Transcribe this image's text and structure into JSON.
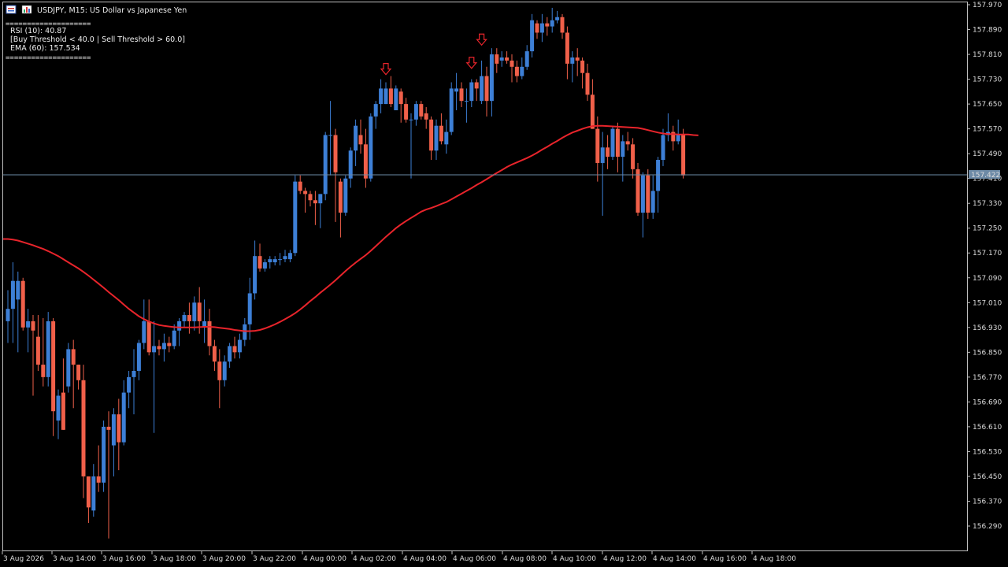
{
  "header": {
    "symbol_title": "USDJPY, M15:  US Dollar vs Japanese Yen"
  },
  "info_panel": {
    "separator": "====================",
    "rsi": "RSI (10): 40.87",
    "thresholds": "[Buy Threshold < 40.0 | Sell Threshold > 60.0]",
    "ema": "EMA (60): 157.534"
  },
  "price_scale": [
    "157.970",
    "157.890",
    "157.810",
    "157.730",
    "157.650",
    "157.570",
    "157.490",
    "157.410",
    "157.330",
    "157.250",
    "157.170",
    "157.090",
    "157.010",
    "156.930",
    "156.850",
    "156.770",
    "156.690",
    "156.610",
    "156.530",
    "156.450",
    "156.370",
    "156.290"
  ],
  "time_scale": [
    "3 Aug 2026",
    "3 Aug 14:00",
    "3 Aug 16:00",
    "3 Aug 18:00",
    "3 Aug 20:00",
    "3 Aug 22:00",
    "4 Aug 00:00",
    "4 Aug 02:00",
    "4 Aug 04:00",
    "4 Aug 06:00",
    "4 Aug 08:00",
    "4 Aug 10:00",
    "4 Aug 12:00",
    "4 Aug 14:00",
    "4 Aug 16:00",
    "4 Aug 18:00"
  ],
  "current_price": {
    "label": "157.422",
    "value": 157.422
  },
  "colors": {
    "background": "#000000",
    "bull": "#3d7fd6",
    "bear": "#f0604a",
    "ema": "#e8242b",
    "price_line": "#6d8aa6",
    "axis": "#cccccc"
  },
  "chart_data": {
    "type": "candlestick",
    "symbol": "USDJPY",
    "timeframe": "M15",
    "ylim": [
      156.25,
      157.985
    ],
    "candles": [
      {
        "o": 156.95,
        "h": 157.05,
        "l": 156.88,
        "c": 156.99
      },
      {
        "o": 156.99,
        "h": 157.14,
        "l": 156.88,
        "c": 157.08
      },
      {
        "o": 157.02,
        "h": 157.11,
        "l": 156.85,
        "c": 157.08
      },
      {
        "o": 157.08,
        "h": 157.09,
        "l": 156.92,
        "c": 156.93
      },
      {
        "o": 156.93,
        "h": 156.99,
        "l": 156.85,
        "c": 156.95
      },
      {
        "o": 156.95,
        "h": 156.97,
        "l": 156.71,
        "c": 156.92
      },
      {
        "o": 156.9,
        "h": 156.97,
        "l": 156.79,
        "c": 156.81
      },
      {
        "o": 156.81,
        "h": 156.96,
        "l": 156.74,
        "c": 156.77
      },
      {
        "o": 156.77,
        "h": 156.98,
        "l": 156.74,
        "c": 156.95
      },
      {
        "o": 156.95,
        "h": 156.96,
        "l": 156.58,
        "c": 156.66
      },
      {
        "o": 156.63,
        "h": 156.73,
        "l": 156.57,
        "c": 156.71
      },
      {
        "o": 156.72,
        "h": 156.83,
        "l": 156.6,
        "c": 156.6
      },
      {
        "o": 156.74,
        "h": 156.88,
        "l": 156.72,
        "c": 156.86
      },
      {
        "o": 156.86,
        "h": 156.89,
        "l": 156.67,
        "c": 156.81
      },
      {
        "o": 156.81,
        "h": 156.81,
        "l": 156.73,
        "c": 156.76
      },
      {
        "o": 156.76,
        "h": 156.81,
        "l": 156.38,
        "c": 156.45
      },
      {
        "o": 156.45,
        "h": 156.45,
        "l": 156.3,
        "c": 156.35
      },
      {
        "o": 156.34,
        "h": 156.49,
        "l": 156.32,
        "c": 156.45
      },
      {
        "o": 156.45,
        "h": 156.55,
        "l": 156.4,
        "c": 156.43
      },
      {
        "o": 156.43,
        "h": 156.63,
        "l": 156.4,
        "c": 156.61
      },
      {
        "o": 156.61,
        "h": 156.66,
        "l": 156.25,
        "c": 156.6
      },
      {
        "o": 156.55,
        "h": 156.67,
        "l": 156.45,
        "c": 156.65
      },
      {
        "o": 156.65,
        "h": 156.7,
        "l": 156.47,
        "c": 156.56
      },
      {
        "o": 156.56,
        "h": 156.76,
        "l": 156.55,
        "c": 156.72
      },
      {
        "o": 156.72,
        "h": 156.79,
        "l": 156.67,
        "c": 156.77
      },
      {
        "o": 156.77,
        "h": 156.86,
        "l": 156.65,
        "c": 156.79
      },
      {
        "o": 156.79,
        "h": 156.89,
        "l": 156.76,
        "c": 156.88
      },
      {
        "o": 156.88,
        "h": 157.02,
        "l": 156.86,
        "c": 156.95
      },
      {
        "o": 156.95,
        "h": 157.02,
        "l": 156.84,
        "c": 156.85
      },
      {
        "o": 156.85,
        "h": 156.95,
        "l": 156.59,
        "c": 156.87
      },
      {
        "o": 156.87,
        "h": 156.89,
        "l": 156.84,
        "c": 156.86
      },
      {
        "o": 156.86,
        "h": 156.91,
        "l": 156.82,
        "c": 156.88
      },
      {
        "o": 156.88,
        "h": 156.9,
        "l": 156.85,
        "c": 156.87
      },
      {
        "o": 156.87,
        "h": 156.94,
        "l": 156.86,
        "c": 156.92
      },
      {
        "o": 156.92,
        "h": 156.96,
        "l": 156.87,
        "c": 156.95
      },
      {
        "o": 156.95,
        "h": 156.98,
        "l": 156.93,
        "c": 156.97
      },
      {
        "o": 156.97,
        "h": 157.01,
        "l": 156.91,
        "c": 156.95
      },
      {
        "o": 156.95,
        "h": 157.03,
        "l": 156.92,
        "c": 157.01
      },
      {
        "o": 157.01,
        "h": 157.06,
        "l": 156.91,
        "c": 156.95
      },
      {
        "o": 156.93,
        "h": 157.02,
        "l": 156.88,
        "c": 156.95
      },
      {
        "o": 156.95,
        "h": 156.99,
        "l": 156.84,
        "c": 156.87
      },
      {
        "o": 156.87,
        "h": 156.89,
        "l": 156.79,
        "c": 156.82
      },
      {
        "o": 156.82,
        "h": 156.86,
        "l": 156.67,
        "c": 156.76
      },
      {
        "o": 156.76,
        "h": 156.84,
        "l": 156.74,
        "c": 156.82
      },
      {
        "o": 156.82,
        "h": 156.88,
        "l": 156.8,
        "c": 156.87
      },
      {
        "o": 156.87,
        "h": 156.9,
        "l": 156.83,
        "c": 156.85
      },
      {
        "o": 156.85,
        "h": 156.91,
        "l": 156.83,
        "c": 156.89
      },
      {
        "o": 156.89,
        "h": 156.96,
        "l": 156.87,
        "c": 156.94
      },
      {
        "o": 156.94,
        "h": 157.09,
        "l": 156.89,
        "c": 157.04
      },
      {
        "o": 157.04,
        "h": 157.21,
        "l": 157.02,
        "c": 157.16
      },
      {
        "o": 157.16,
        "h": 157.2,
        "l": 157.11,
        "c": 157.12
      },
      {
        "o": 157.12,
        "h": 157.15,
        "l": 157.11,
        "c": 157.14
      },
      {
        "o": 157.14,
        "h": 157.16,
        "l": 157.12,
        "c": 157.15
      },
      {
        "o": 157.14,
        "h": 157.16,
        "l": 157.13,
        "c": 157.15
      },
      {
        "o": 157.15,
        "h": 157.17,
        "l": 157.13,
        "c": 157.15
      },
      {
        "o": 157.15,
        "h": 157.18,
        "l": 157.14,
        "c": 157.16
      },
      {
        "o": 157.15,
        "h": 157.18,
        "l": 157.14,
        "c": 157.17
      },
      {
        "o": 157.17,
        "h": 157.42,
        "l": 157.16,
        "c": 157.4
      },
      {
        "o": 157.4,
        "h": 157.42,
        "l": 157.36,
        "c": 157.37
      },
      {
        "o": 157.37,
        "h": 157.38,
        "l": 157.3,
        "c": 157.36
      },
      {
        "o": 157.36,
        "h": 157.37,
        "l": 157.32,
        "c": 157.34
      },
      {
        "o": 157.34,
        "h": 157.37,
        "l": 157.26,
        "c": 157.33
      },
      {
        "o": 157.33,
        "h": 157.36,
        "l": 157.25,
        "c": 157.36
      },
      {
        "o": 157.36,
        "h": 157.56,
        "l": 157.34,
        "c": 157.55
      },
      {
        "o": 157.55,
        "h": 157.66,
        "l": 157.42,
        "c": 157.55
      },
      {
        "o": 157.55,
        "h": 157.57,
        "l": 157.27,
        "c": 157.43
      },
      {
        "o": 157.4,
        "h": 157.41,
        "l": 157.22,
        "c": 157.3
      },
      {
        "o": 157.3,
        "h": 157.42,
        "l": 157.29,
        "c": 157.41
      },
      {
        "o": 157.41,
        "h": 157.51,
        "l": 157.38,
        "c": 157.5
      },
      {
        "o": 157.5,
        "h": 157.6,
        "l": 157.45,
        "c": 157.58
      },
      {
        "o": 157.55,
        "h": 157.6,
        "l": 157.49,
        "c": 157.52
      },
      {
        "o": 157.52,
        "h": 157.57,
        "l": 157.38,
        "c": 157.41
      },
      {
        "o": 157.41,
        "h": 157.62,
        "l": 157.4,
        "c": 157.61
      },
      {
        "o": 157.61,
        "h": 157.66,
        "l": 157.57,
        "c": 157.65
      },
      {
        "o": 157.65,
        "h": 157.73,
        "l": 157.62,
        "c": 157.7
      },
      {
        "o": 157.65,
        "h": 157.72,
        "l": 157.65,
        "c": 157.7
      },
      {
        "o": 157.7,
        "h": 157.74,
        "l": 157.64,
        "c": 157.65
      },
      {
        "o": 157.63,
        "h": 157.71,
        "l": 157.63,
        "c": 157.7
      },
      {
        "o": 157.69,
        "h": 157.7,
        "l": 157.59,
        "c": 157.65
      },
      {
        "o": 157.65,
        "h": 157.67,
        "l": 157.59,
        "c": 157.6
      },
      {
        "o": 157.6,
        "h": 157.62,
        "l": 157.41,
        "c": 157.6
      },
      {
        "o": 157.6,
        "h": 157.66,
        "l": 157.58,
        "c": 157.65
      },
      {
        "o": 157.65,
        "h": 157.66,
        "l": 157.6,
        "c": 157.61
      },
      {
        "o": 157.62,
        "h": 157.64,
        "l": 157.57,
        "c": 157.6
      },
      {
        "o": 157.6,
        "h": 157.61,
        "l": 157.47,
        "c": 157.5
      },
      {
        "o": 157.5,
        "h": 157.6,
        "l": 157.47,
        "c": 157.58
      },
      {
        "o": 157.58,
        "h": 157.62,
        "l": 157.52,
        "c": 157.53
      },
      {
        "o": 157.52,
        "h": 157.6,
        "l": 157.49,
        "c": 157.56
      },
      {
        "o": 157.56,
        "h": 157.72,
        "l": 157.55,
        "c": 157.7
      },
      {
        "o": 157.69,
        "h": 157.75,
        "l": 157.63,
        "c": 157.7
      },
      {
        "o": 157.7,
        "h": 157.72,
        "l": 157.64,
        "c": 157.66
      },
      {
        "o": 157.66,
        "h": 157.7,
        "l": 157.59,
        "c": 157.66
      },
      {
        "o": 157.66,
        "h": 157.73,
        "l": 157.64,
        "c": 157.72
      },
      {
        "o": 157.72,
        "h": 157.73,
        "l": 157.66,
        "c": 157.7
      },
      {
        "o": 157.66,
        "h": 157.79,
        "l": 157.65,
        "c": 157.74
      },
      {
        "o": 157.74,
        "h": 157.77,
        "l": 157.61,
        "c": 157.66
      },
      {
        "o": 157.66,
        "h": 157.83,
        "l": 157.61,
        "c": 157.81
      },
      {
        "o": 157.81,
        "h": 157.83,
        "l": 157.75,
        "c": 157.78
      },
      {
        "o": 157.79,
        "h": 157.82,
        "l": 157.77,
        "c": 157.8
      },
      {
        "o": 157.8,
        "h": 157.82,
        "l": 157.78,
        "c": 157.79
      },
      {
        "o": 157.79,
        "h": 157.81,
        "l": 157.72,
        "c": 157.77
      },
      {
        "o": 157.77,
        "h": 157.79,
        "l": 157.72,
        "c": 157.74
      },
      {
        "o": 157.74,
        "h": 157.8,
        "l": 157.73,
        "c": 157.77
      },
      {
        "o": 157.77,
        "h": 157.84,
        "l": 157.76,
        "c": 157.82
      },
      {
        "o": 157.82,
        "h": 157.94,
        "l": 157.8,
        "c": 157.92
      },
      {
        "o": 157.91,
        "h": 157.92,
        "l": 157.86,
        "c": 157.88
      },
      {
        "o": 157.88,
        "h": 157.94,
        "l": 157.85,
        "c": 157.91
      },
      {
        "o": 157.91,
        "h": 157.93,
        "l": 157.87,
        "c": 157.9
      },
      {
        "o": 157.9,
        "h": 157.96,
        "l": 157.88,
        "c": 157.92
      },
      {
        "o": 157.92,
        "h": 157.95,
        "l": 157.91,
        "c": 157.93
      },
      {
        "o": 157.93,
        "h": 157.94,
        "l": 157.86,
        "c": 157.88
      },
      {
        "o": 157.88,
        "h": 157.9,
        "l": 157.73,
        "c": 157.78
      },
      {
        "o": 157.78,
        "h": 157.82,
        "l": 157.72,
        "c": 157.8
      },
      {
        "o": 157.8,
        "h": 157.83,
        "l": 157.74,
        "c": 157.79
      },
      {
        "o": 157.79,
        "h": 157.8,
        "l": 157.7,
        "c": 157.75
      },
      {
        "o": 157.75,
        "h": 157.78,
        "l": 157.66,
        "c": 157.68
      },
      {
        "o": 157.68,
        "h": 157.73,
        "l": 157.57,
        "c": 157.57
      },
      {
        "o": 157.57,
        "h": 157.61,
        "l": 157.4,
        "c": 157.46
      },
      {
        "o": 157.46,
        "h": 157.56,
        "l": 157.29,
        "c": 157.51
      },
      {
        "o": 157.51,
        "h": 157.55,
        "l": 157.44,
        "c": 157.48
      },
      {
        "o": 157.48,
        "h": 157.58,
        "l": 157.47,
        "c": 157.57
      },
      {
        "o": 157.57,
        "h": 157.59,
        "l": 157.43,
        "c": 157.48
      },
      {
        "o": 157.48,
        "h": 157.55,
        "l": 157.4,
        "c": 157.53
      },
      {
        "o": 157.53,
        "h": 157.56,
        "l": 157.5,
        "c": 157.52
      },
      {
        "o": 157.52,
        "h": 157.54,
        "l": 157.41,
        "c": 157.44
      },
      {
        "o": 157.44,
        "h": 157.46,
        "l": 157.29,
        "c": 157.3
      },
      {
        "o": 157.3,
        "h": 157.43,
        "l": 157.22,
        "c": 157.42
      },
      {
        "o": 157.42,
        "h": 157.44,
        "l": 157.28,
        "c": 157.3
      },
      {
        "o": 157.3,
        "h": 157.42,
        "l": 157.28,
        "c": 157.37
      },
      {
        "o": 157.37,
        "h": 157.48,
        "l": 157.3,
        "c": 157.47
      },
      {
        "o": 157.47,
        "h": 157.57,
        "l": 157.45,
        "c": 157.55
      },
      {
        "o": 157.55,
        "h": 157.62,
        "l": 157.53,
        "c": 157.56
      },
      {
        "o": 157.56,
        "h": 157.58,
        "l": 157.5,
        "c": 157.53
      },
      {
        "o": 157.53,
        "h": 157.6,
        "l": 157.52,
        "c": 157.55
      },
      {
        "o": 157.55,
        "h": 157.57,
        "l": 157.41,
        "c": 157.42
      }
    ],
    "ema": {
      "name": "EMA (60)",
      "values": [
        157.215,
        157.213,
        157.21,
        157.205,
        157.2,
        157.195,
        157.189,
        157.183,
        157.176,
        157.168,
        157.16,
        157.15,
        157.14,
        157.13,
        157.12,
        157.109,
        157.097,
        157.084,
        157.071,
        157.058,
        157.044,
        157.031,
        157.018,
        157.004,
        156.99,
        156.978,
        156.966,
        156.957,
        156.949,
        156.943,
        156.938,
        156.935,
        156.933,
        156.931,
        156.93,
        156.93,
        156.93,
        156.93,
        156.931,
        156.932,
        156.932,
        156.931,
        156.929,
        156.927,
        156.925,
        156.922,
        156.92,
        156.918,
        156.918,
        156.919,
        156.922,
        156.927,
        156.933,
        156.94,
        156.948,
        156.957,
        156.966,
        156.976,
        156.988,
        157.001,
        157.015,
        157.028,
        157.042,
        157.055,
        157.068,
        157.082,
        157.097,
        157.112,
        157.126,
        157.139,
        157.151,
        157.163,
        157.177,
        157.192,
        157.207,
        157.222,
        157.236,
        157.25,
        157.262,
        157.273,
        157.283,
        157.293,
        157.303,
        157.31,
        157.315,
        157.321,
        157.328,
        157.334,
        157.343,
        157.352,
        157.361,
        157.37,
        157.379,
        157.389,
        157.398,
        157.408,
        157.418,
        157.428,
        157.437,
        157.447,
        157.455,
        157.462,
        157.469,
        157.476,
        157.484,
        157.493,
        157.503,
        157.512,
        157.522,
        157.531,
        157.541,
        157.55,
        157.558,
        157.564,
        157.57,
        157.575,
        157.579,
        157.58,
        157.58,
        157.579,
        157.578,
        157.577,
        157.576,
        157.575,
        157.574,
        157.573,
        157.57,
        157.566,
        157.562,
        157.558,
        157.555,
        157.553,
        157.553,
        157.552,
        157.552,
        157.552,
        157.55,
        157.549
      ]
    },
    "sell_signals": [
      {
        "index": 75,
        "price": 157.745
      },
      {
        "index": 92,
        "price": 157.765
      },
      {
        "index": 94,
        "price": 157.84
      }
    ]
  }
}
